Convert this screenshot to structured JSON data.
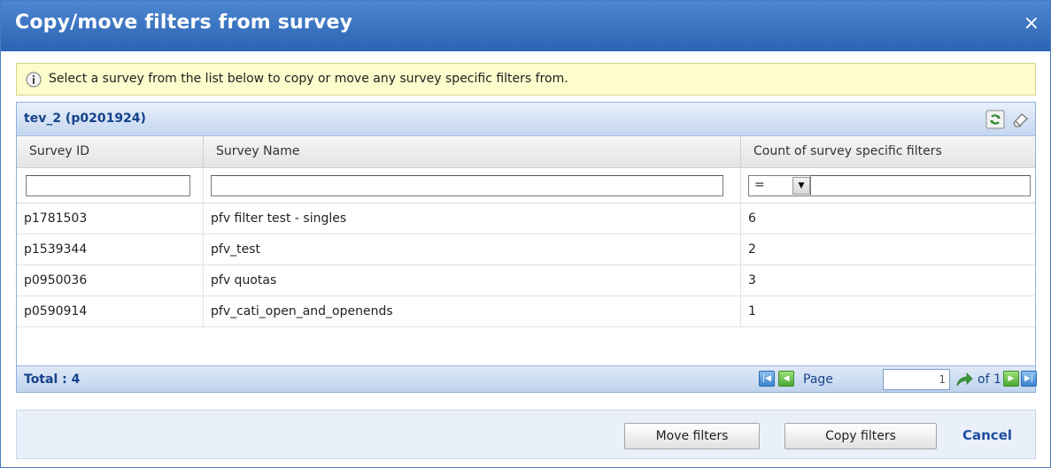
{
  "dialog": {
    "title": "Copy/move filters from survey",
    "close_label": "×"
  },
  "info": {
    "text": "Select a survey from the list below to copy or move any survey specific filters from."
  },
  "grid": {
    "title": "tev_2 (p0201924)",
    "columns": [
      "Survey ID",
      "Survey Name",
      "Count of survey specific filters"
    ],
    "filter": {
      "survey_id_value": "",
      "survey_name_value": "",
      "operator": "=",
      "count_value": ""
    },
    "rows": [
      {
        "id": "p1781503",
        "name": "pfv filter test - singles",
        "count": "6"
      },
      {
        "id": "p1539344",
        "name": "pfv_test",
        "count": "2"
      },
      {
        "id": "p0950036",
        "name": "pfv quotas",
        "count": "3"
      },
      {
        "id": "p0590914",
        "name": "pfv_cati_open_and_openends",
        "count": "1"
      }
    ],
    "total_label": "Total : 4",
    "pager": {
      "page_label": "Page",
      "page_value": "1",
      "of_label": "of 1"
    }
  },
  "buttons": {
    "move": "Move filters",
    "copy": "Copy filters",
    "cancel": "Cancel"
  },
  "colors": {
    "title_bar": "#2b64b3",
    "info_bg": "#fcfccc",
    "cancel_link": "#1f4f9e"
  }
}
